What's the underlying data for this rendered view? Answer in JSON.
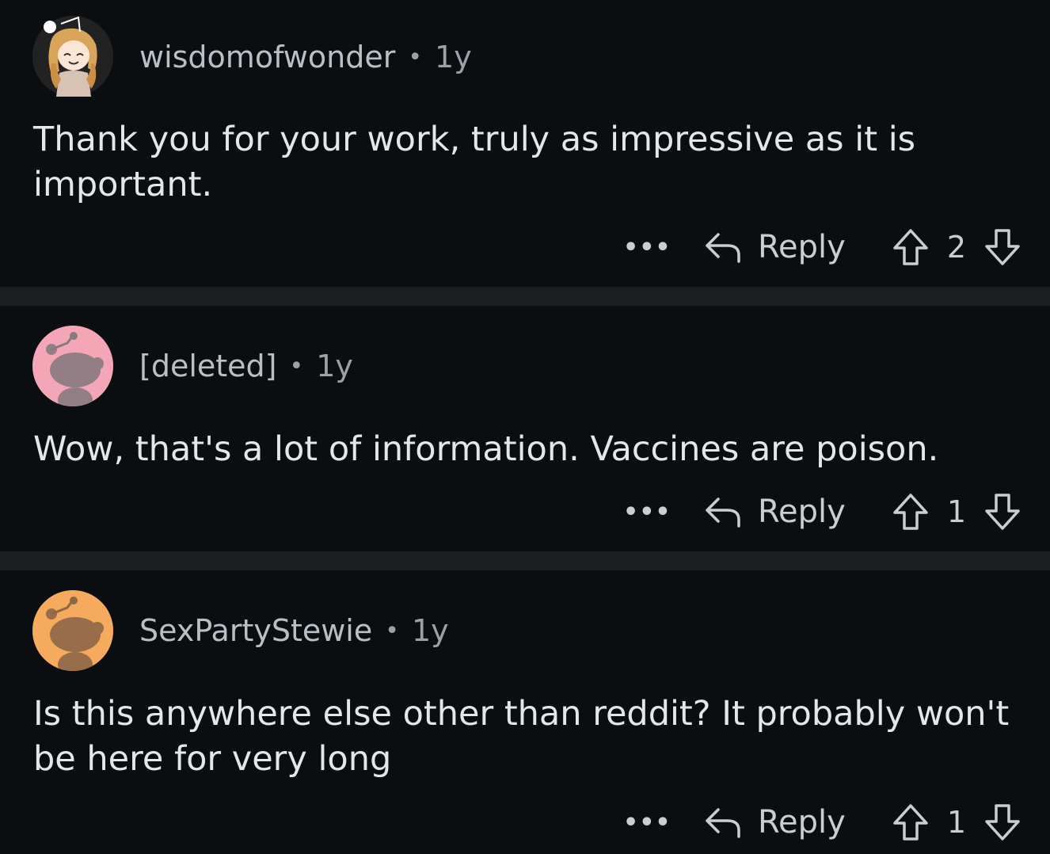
{
  "comments": [
    {
      "username": "wisdomofwonder",
      "age": "1y",
      "body": "Thank you for your work, truly as impressive as it is important.",
      "more_label": "•••",
      "reply_label": "Reply",
      "score": "2",
      "avatar_icon": "custom-avatar-icon"
    },
    {
      "username": "[deleted]",
      "age": "1y",
      "body": "Wow, that's a lot of information. Vaccines are poison.",
      "more_label": "•••",
      "reply_label": "Reply",
      "score": "1",
      "avatar_icon": "snoo-avatar-icon",
      "avatar_color": "#f3a6b6"
    },
    {
      "username": "SexPartyStewie",
      "age": "1y",
      "body": "Is this anywhere else other than reddit? It probably won't be here for very long",
      "more_label": "•••",
      "reply_label": "Reply",
      "score": "1",
      "avatar_icon": "snoo-avatar-icon",
      "avatar_color": "#f5aa5e"
    }
  ],
  "colors": {
    "background": "#0b0e11",
    "divider": "#1c1e21",
    "text": "#e4e6e8",
    "meta": "#9aa1a7"
  }
}
